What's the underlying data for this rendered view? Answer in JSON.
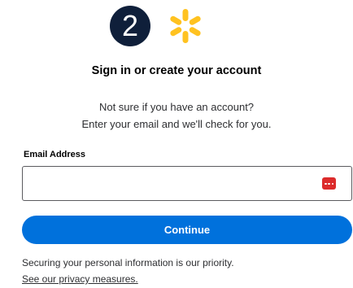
{
  "header": {
    "step_number": "2",
    "logo_icon": "walmart-spark-icon",
    "logo_color": "#ffc220",
    "step_badge_color": "#0f1f3a"
  },
  "main": {
    "heading": "Sign in or create your account",
    "intro_line_1": "Not sure if you have an account?",
    "intro_line_2": "Enter your email and we'll check for you."
  },
  "form": {
    "email_label": "Email Address",
    "email_value": "",
    "email_placeholder": "",
    "autofill_icon": "password-manager-icon",
    "autofill_icon_color": "#dc2b2b",
    "continue_label": "Continue",
    "button_color": "#0071dc"
  },
  "footer": {
    "privacy_note": "Securing your personal information is our priority.",
    "privacy_link": "See our privacy measures."
  }
}
